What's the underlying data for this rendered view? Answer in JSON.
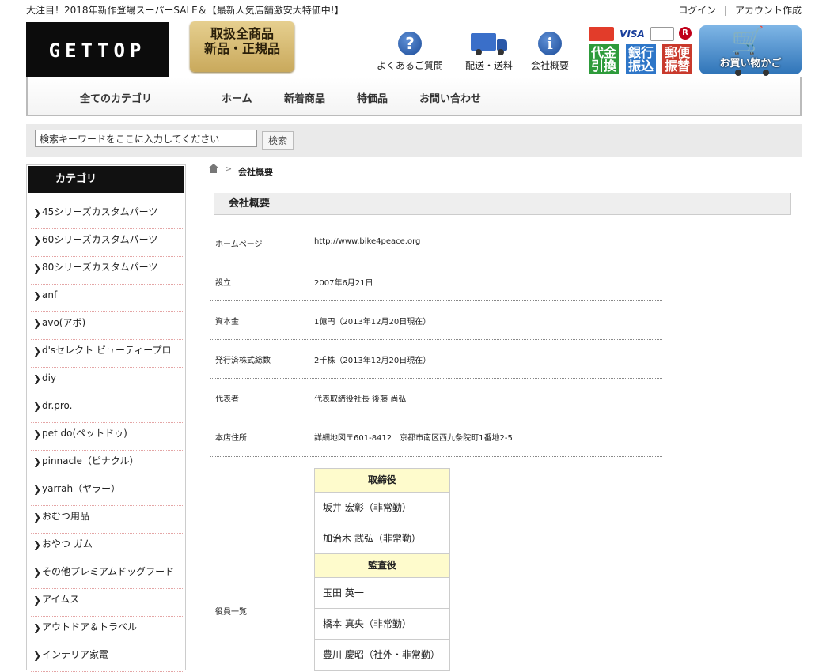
{
  "topbar": {
    "announcement": "大注目！2018年新作登場スーパーSALE＆【最新人気店舗激安大特価中!】",
    "login": "ログイン",
    "separator": "|",
    "create_account": "アカウント作成"
  },
  "header": {
    "logo_text": "GETTOP",
    "seal_line1": "取扱全商品",
    "seal_line2": "新品・正規品",
    "faq": "よくあるご質問",
    "shipping": "配送・送料",
    "company": "会社概要",
    "cards": [
      "VISA"
    ],
    "payment_methods": [
      {
        "l1": "代金",
        "l2": "引換",
        "color": "#2e9b3b"
      },
      {
        "l1": "銀行",
        "l2": "振込",
        "color": "#2e76c8"
      },
      {
        "l1": "郵便",
        "l2": "振替",
        "color": "#c93a2d"
      }
    ],
    "cart_label": "お買い物かご"
  },
  "nav": {
    "all_categories": "全てのカテゴリ",
    "home": "ホーム",
    "new_items": "新着商品",
    "sale_items": "特価品",
    "contact": "お問い合わせ"
  },
  "search": {
    "placeholder": "検索キーワードをここに入力してください",
    "button": "検索"
  },
  "sidebar": {
    "title": "カテゴリ",
    "items": [
      "45シリーズカスタムパーツ",
      "60シリーズカスタムパーツ",
      "80シリーズカスタムパーツ",
      "anf",
      "avo(アボ)",
      "d'sセレクト ビューティープロ",
      "diy",
      "dr.pro.",
      "pet do(ペットドゥ)",
      "pinnacle（ピナクル）",
      "yarrah（ヤラー）",
      "おむつ用品",
      "おやつ ガム",
      "その他プレミアムドッグフード",
      "アイムス",
      "アウトドア＆トラベル",
      "インテリア家電"
    ]
  },
  "breadcrumb": {
    "arrow": ">",
    "current": "会社概要"
  },
  "main": {
    "section_title": "会社概要",
    "rows": [
      {
        "label": "ホームページ",
        "value": "http://www.bike4peace.org"
      },
      {
        "label": "設立",
        "value": "2007年6月21日"
      },
      {
        "label": "資本金",
        "value": "1億円（2013年12月20日現在）"
      },
      {
        "label": "発行済株式総数",
        "value": "2千株（2013年12月20日現在）"
      },
      {
        "label": "代表者",
        "value": "代表取締役社長 後藤 尚弘"
      },
      {
        "label": "本店住所",
        "value": "詳細地図〒601-8412　京都市南区西九条院町1番地2-5"
      }
    ],
    "officers_label": "役員一覧",
    "directors_header": "取締役",
    "directors": [
      "坂井 宏彰（非常勤）",
      "加治木 武弘（非常勤）"
    ],
    "auditors_header": "監査役",
    "auditors": [
      "玉田 英一",
      "橋本 真央（非常勤）",
      "豊川 慶昭（社外・非常勤）"
    ]
  }
}
